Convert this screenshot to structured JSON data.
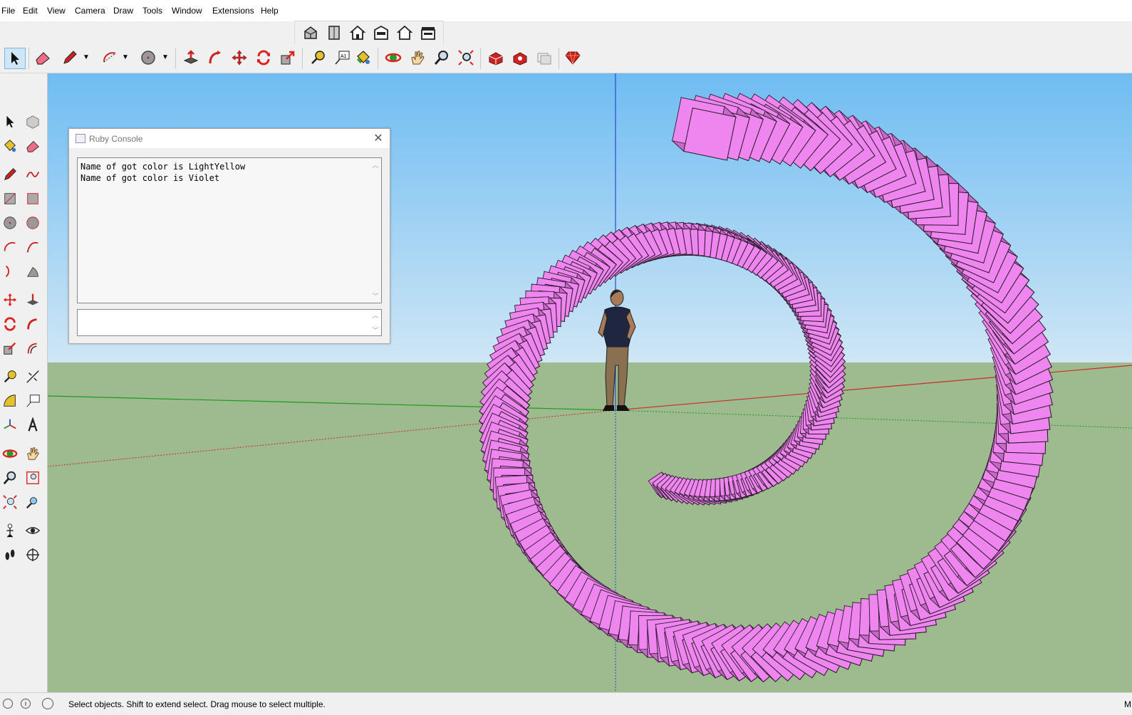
{
  "menu": [
    "File",
    "Edit",
    "View",
    "Camera",
    "Draw",
    "Tools",
    "Window",
    "Extensions",
    "Help"
  ],
  "views_toolbar": [
    "iso-view",
    "top-view",
    "front-view",
    "right-view",
    "back-view",
    "left-view"
  ],
  "main_toolbar": [
    "select",
    "eraser",
    "line",
    "arc",
    "circle",
    "push-pull",
    "follow-me",
    "move",
    "rotate",
    "scale",
    "tape-measure",
    "text",
    "paint-bucket",
    "orbit",
    "pan",
    "zoom",
    "zoom-extents",
    "warehouse-3d",
    "extension-warehouse",
    "layout",
    "ruby"
  ],
  "ruby_console": {
    "title": "Ruby Console",
    "close": "✕",
    "output_lines": [
      "Name of got color is LightYellow",
      "Name of got color is Violet"
    ],
    "input_value": ""
  },
  "status": {
    "text": "Select objects. Shift to extend select. Drag mouse to select multiple.",
    "right_text": "M"
  },
  "colors": {
    "sky": "#8cc8f0",
    "ground": "#9dbb8e",
    "model": "#ef86ef",
    "model_edge": "#2a1a2a",
    "x_axis": "#cc2a2a",
    "y_axis": "#1f9a1f",
    "z_axis": "#2a4acc"
  }
}
